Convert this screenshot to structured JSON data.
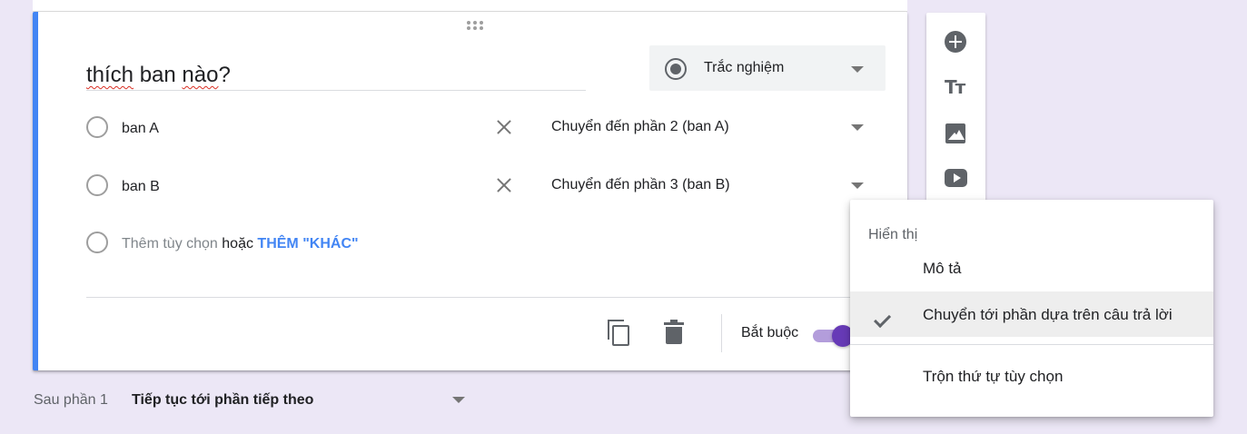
{
  "question": {
    "title_parts": [
      "thích",
      " ban ",
      "nào",
      "?"
    ],
    "type_label": "Trắc nghiệm"
  },
  "options": [
    {
      "label": "ban A",
      "goto": "Chuyển đến phần 2 (ban A)"
    },
    {
      "label": "ban B",
      "goto": "Chuyển đến phần 3 (ban B)"
    }
  ],
  "add_option": {
    "placeholder": "Thêm tùy chọn",
    "or_text": " hoặc ",
    "other_link": "THÊM \"KHÁC\""
  },
  "footer": {
    "required_label": "Bắt buộc",
    "required_on": true
  },
  "after_section": {
    "label": "Sau phần 1",
    "value": "Tiếp tục tới phần tiếp theo"
  },
  "side_toolbar": {
    "text_icon_glyph": "Tт",
    "icons": [
      "add-question-icon",
      "title-text-icon",
      "image-icon",
      "video-icon"
    ]
  },
  "menu": {
    "header": "Hiển thị",
    "items": [
      {
        "label": "Mô tả",
        "checked": false
      },
      {
        "label": "Chuyển tới phần dựa trên câu trả lời",
        "checked": true
      },
      {
        "label": "Trộn thứ tự tùy chọn",
        "checked": false
      }
    ]
  },
  "colors": {
    "background": "#ece7f6",
    "accent_blue": "#4285f4",
    "toggle_purple": "#673ab7"
  }
}
